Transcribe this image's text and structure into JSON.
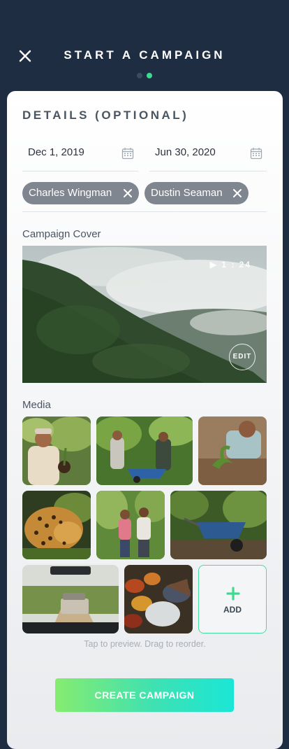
{
  "header": {
    "title": "START A CAMPAIGN",
    "steps": {
      "current": 2,
      "total": 2
    }
  },
  "details": {
    "section_title": "DETAILS (OPTIONAL)",
    "start_date": "Dec 1, 2019",
    "end_date": "Jun 30, 2020",
    "tags": [
      "Charles Wingman",
      "Dustin Seaman"
    ]
  },
  "cover": {
    "label": "Campaign Cover",
    "duration": "▶ 1 : 24",
    "edit_label": "EDIT"
  },
  "media": {
    "label": "Media",
    "add_label": "ADD",
    "hint": "Tap to preview. Drag to reorder."
  },
  "actions": {
    "create_label": "CREATE CAMPAIGN"
  },
  "colors": {
    "background": "#1f2d43",
    "accent": "#3fd98f",
    "tag": "#7f868f"
  }
}
